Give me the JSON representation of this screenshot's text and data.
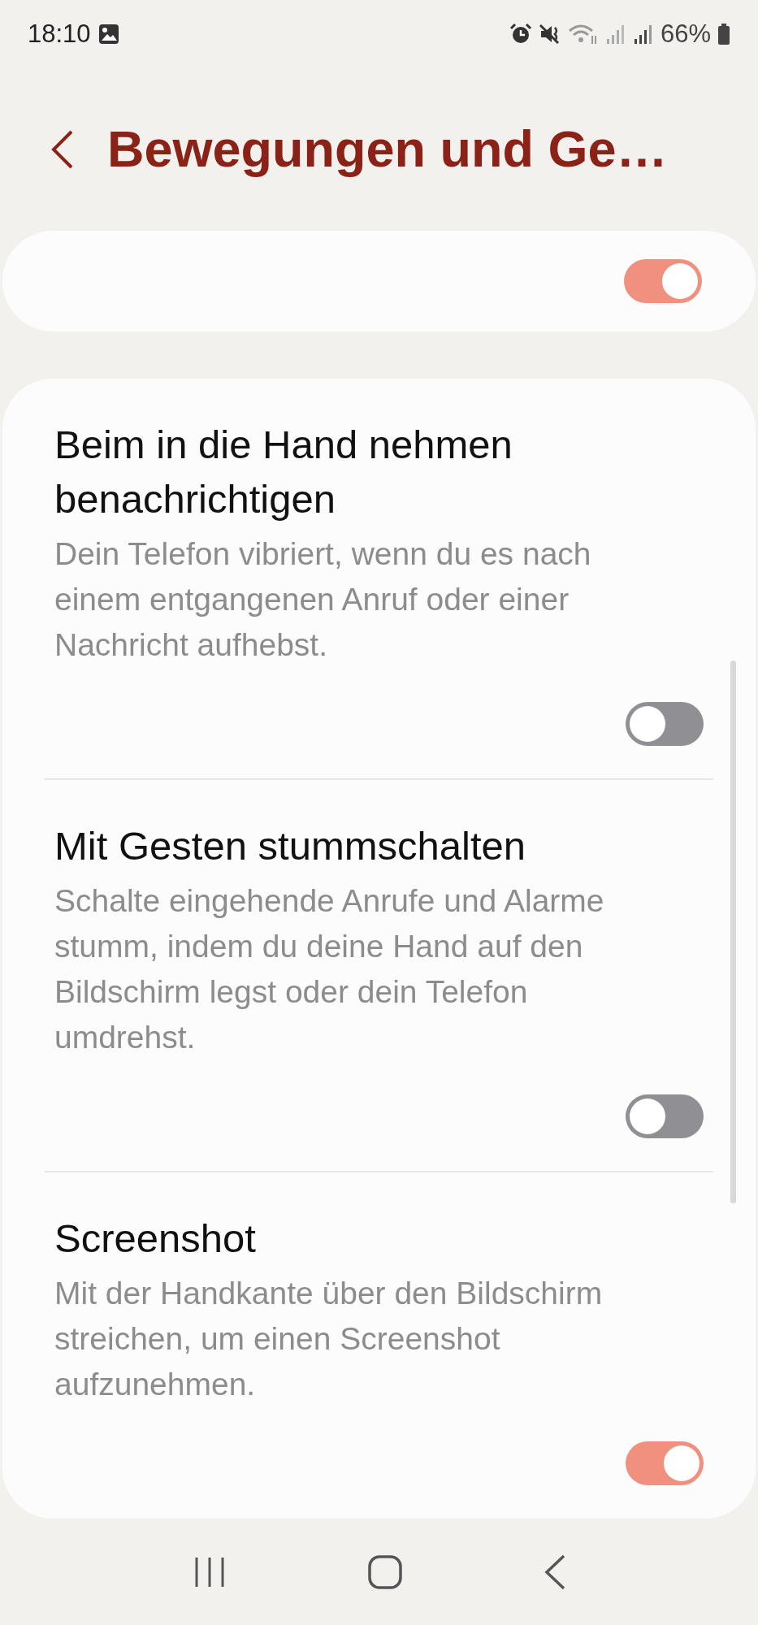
{
  "status_bar": {
    "time": "18:10",
    "battery": "66%"
  },
  "header": {
    "title": "Bewegungen und Ge…"
  },
  "master_switch": {
    "on": true
  },
  "settings": [
    {
      "title": "Beim in die Hand nehmen benachrichtigen",
      "description": "Dein Telefon vibriert, wenn du es nach einem entgangenen Anruf oder einer Nachricht aufhebst.",
      "on": false
    },
    {
      "title": "Mit Gesten stummschalten",
      "description": "Schalte eingehende Anrufe und Alarme stumm, indem du deine Hand auf den Bildschirm legst oder dein Telefon umdrehst.",
      "on": false
    },
    {
      "title": "Screenshot",
      "description": "Mit der Handkante über den Bildschirm streichen, um einen Screenshot aufzunehmen.",
      "on": true
    }
  ]
}
